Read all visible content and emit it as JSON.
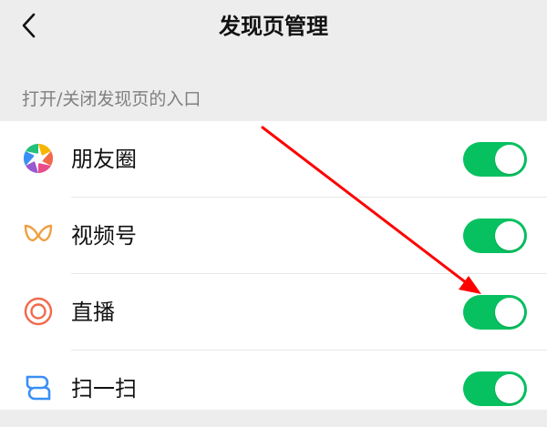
{
  "header": {
    "title": "发现页管理",
    "back_icon": "chevron-left-icon"
  },
  "section": {
    "label": "打开/关闭发现页的入口"
  },
  "items": [
    {
      "label": "朋友圈",
      "icon": "moments-aperture-icon",
      "enabled": true
    },
    {
      "label": "视频号",
      "icon": "channels-icon",
      "enabled": true
    },
    {
      "label": "直播",
      "icon": "live-icon",
      "enabled": true
    },
    {
      "label": "扫一扫",
      "icon": "scan-icon",
      "enabled": true
    }
  ],
  "colors": {
    "background": "#ededed",
    "toggle_on": "#07c160",
    "annotation_arrow": "#ff0000",
    "channels_icon": "#f0a040",
    "live_icon": "#f26a4b",
    "scan_icon": "#3a8ff5"
  }
}
